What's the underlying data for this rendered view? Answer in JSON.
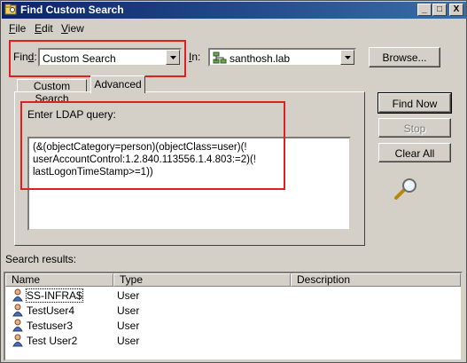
{
  "window": {
    "title": "Find Custom Search",
    "minimize": "_",
    "maximize": "□",
    "close": "X"
  },
  "menu": [
    {
      "key": "F",
      "rest": "ile"
    },
    {
      "key": "E",
      "rest": "dit"
    },
    {
      "key": "V",
      "rest": "iew"
    }
  ],
  "find": {
    "label_pre": "Fin",
    "label_key": "d",
    "label_post": ":",
    "value": "Custom Search"
  },
  "in": {
    "label_key": "I",
    "label_post": "n:",
    "value": "santhosh.lab"
  },
  "browse_label": "Browse...",
  "tabs": [
    {
      "label": "Custom Search"
    },
    {
      "label": "Advanced"
    }
  ],
  "advanced": {
    "query_label": "Enter LDAP query:",
    "query": "(&(objectCategory=person)(objectClass=user)(!\nuserAccountControl:1.2.840.113556.1.4.803:=2)(!\nlastLogonTimeStamp>=1))"
  },
  "buttons": {
    "find_now": "Find Now",
    "stop": "Stop",
    "clear_all": "Clear All"
  },
  "results": {
    "label": "Search results:",
    "columns": [
      "Name",
      "Type",
      "Description"
    ],
    "rows": [
      {
        "name": "SS-INFRA$",
        "type": "User"
      },
      {
        "name": "TestUser4",
        "type": "User"
      },
      {
        "name": "Testuser3",
        "type": "User"
      },
      {
        "name": "Test User2",
        "type": "User"
      }
    ]
  },
  "colors": {
    "annotation_red": "#e02020",
    "title_bar": "#0a246a",
    "face": "#d4d0c8"
  },
  "icons": {
    "app": "search-folder-icon",
    "in": "domain-tree-icon",
    "search": "magnifier-icon",
    "user": "user-icon"
  }
}
